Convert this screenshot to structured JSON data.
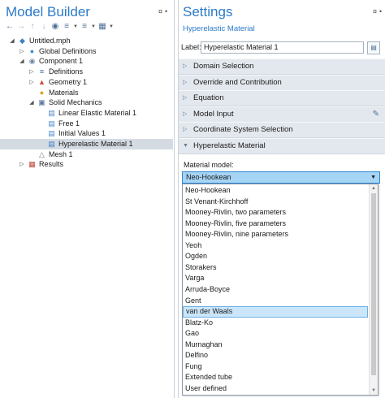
{
  "model_builder": {
    "title": "Model Builder",
    "pin_glyph": "¤",
    "toolbar_icons": [
      "arrow-left-icon",
      "arrow-right-icon",
      "arrow-up-icon",
      "arrow-down-icon",
      "show-icon",
      "collapse-icon",
      "expand-icon",
      "settings-icon"
    ],
    "tree": [
      {
        "label": "Untitled.mph",
        "level": 0,
        "expander": "◢",
        "icon": "model-icon",
        "selected": false
      },
      {
        "label": "Global Definitions",
        "level": 1,
        "expander": "▷",
        "icon": "globe-icon",
        "selected": false
      },
      {
        "label": "Component 1",
        "level": 1,
        "expander": "◢",
        "icon": "component-icon",
        "selected": false
      },
      {
        "label": "Definitions",
        "level": 2,
        "expander": "▷",
        "icon": "definitions-icon",
        "selected": false
      },
      {
        "label": "Geometry 1",
        "level": 2,
        "expander": "▷",
        "icon": "geometry-icon",
        "selected": false
      },
      {
        "label": "Materials",
        "level": 2,
        "expander": "",
        "icon": "materials-icon",
        "selected": false
      },
      {
        "label": "Solid Mechanics",
        "level": 2,
        "expander": "◢",
        "icon": "solid-mechanics-icon",
        "selected": false
      },
      {
        "label": "Linear Elastic Material 1",
        "level": 3,
        "expander": "",
        "icon": "linear-elastic-icon",
        "selected": false
      },
      {
        "label": "Free 1",
        "level": 3,
        "expander": "",
        "icon": "boundary-icon",
        "selected": false
      },
      {
        "label": "Initial Values 1",
        "level": 3,
        "expander": "",
        "icon": "initial-values-icon",
        "selected": false
      },
      {
        "label": "Hyperelastic Material 1",
        "level": 3,
        "expander": "",
        "icon": "hyperelastic-icon",
        "selected": true
      },
      {
        "label": "Mesh 1",
        "level": 2,
        "expander": "",
        "icon": "mesh-icon",
        "selected": false
      },
      {
        "label": "Results",
        "level": 1,
        "expander": "▷",
        "icon": "results-icon",
        "selected": false
      }
    ]
  },
  "settings": {
    "title": "Settings",
    "subtitle": "Hyperelastic Material",
    "pin_glyph": "¤",
    "label_text": "Label:",
    "label_value": "Hyperelastic Material 1",
    "sections": [
      {
        "label": "Domain Selection",
        "expanded": false,
        "edit_icon": false
      },
      {
        "label": "Override and Contribution",
        "expanded": false,
        "edit_icon": false
      },
      {
        "label": "Equation",
        "expanded": false,
        "edit_icon": false
      },
      {
        "label": "Model Input",
        "expanded": false,
        "edit_icon": true
      },
      {
        "label": "Coordinate System Selection",
        "expanded": false,
        "edit_icon": false
      },
      {
        "label": "Hyperelastic Material",
        "expanded": true,
        "edit_icon": false
      }
    ],
    "material_model_label": "Material model:",
    "material_model_value": "Neo-Hookean",
    "options": [
      "Neo-Hookean",
      "St Venant-Kirchhoff",
      "Mooney-Rivlin, two parameters",
      "Mooney-Rivlin, five parameters",
      "Mooney-Rivlin, nine parameters",
      "Yeoh",
      "Ogden",
      "Storakers",
      "Varga",
      "Arruda-Boyce",
      "Gent",
      "van der Waals",
      "Blatz-Ko",
      "Gao",
      "Murnaghan",
      "Delfino",
      "Fung",
      "Extended tube",
      "User defined"
    ],
    "highlighted_option": "van der Waals"
  },
  "colors": {
    "accent": "#2c7bc9",
    "selected_row": "#d5dbe2",
    "section_bg": "#e3e8ee",
    "combo_bg": "#a6d4f5",
    "highlight_bg": "#cbe6fb"
  }
}
